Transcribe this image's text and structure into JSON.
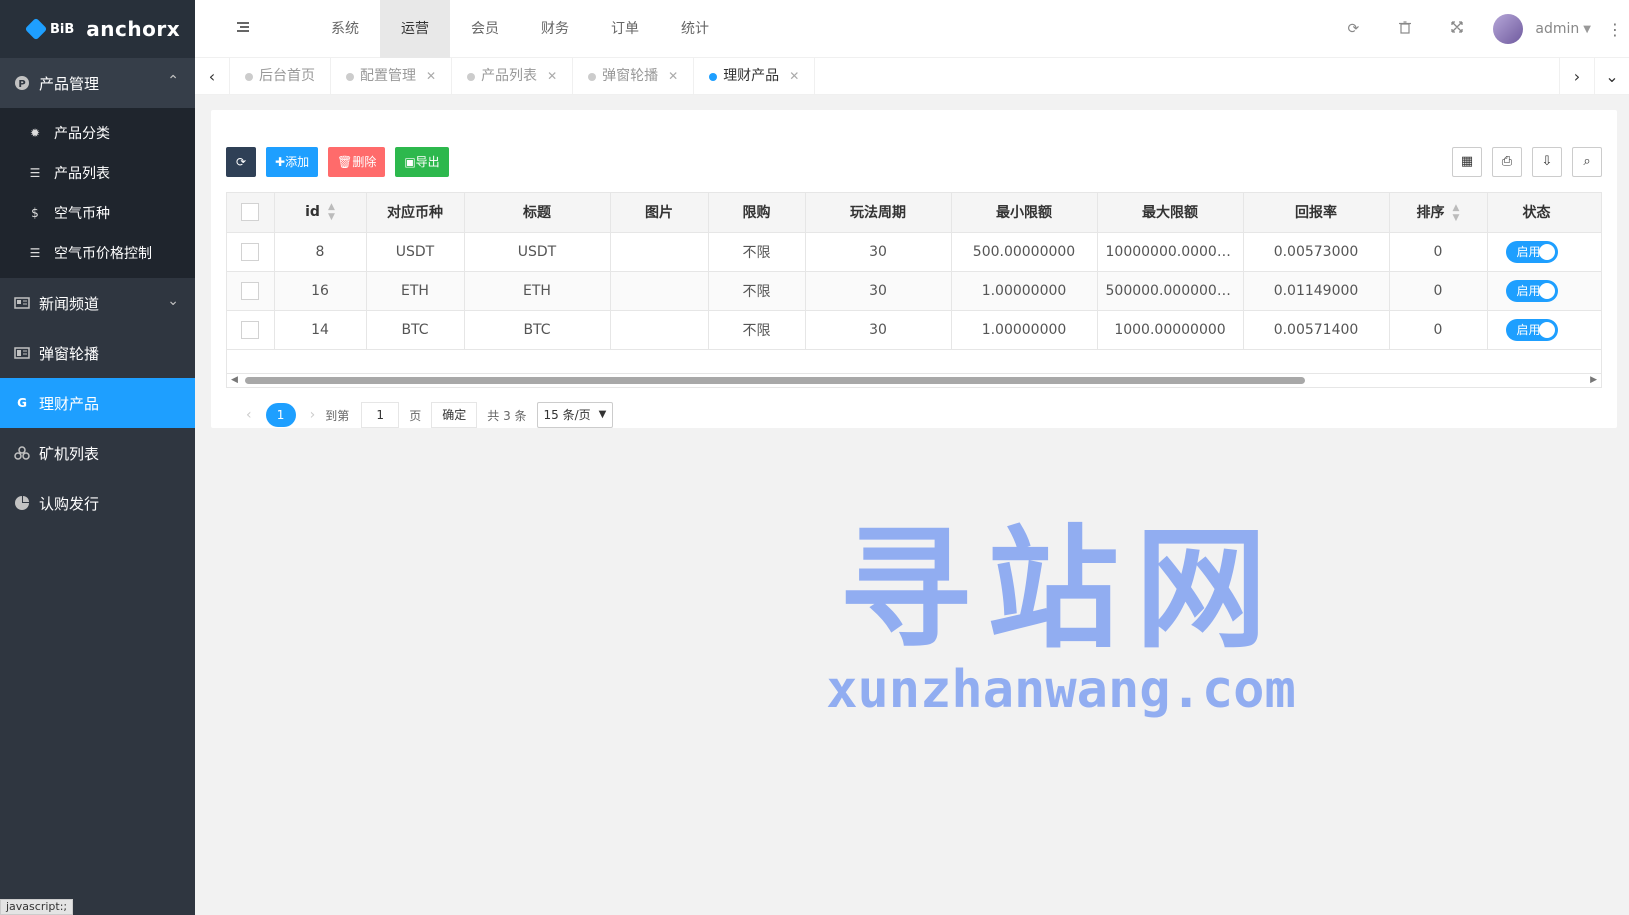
{
  "app": {
    "bib": "BiB",
    "name": "anchorx"
  },
  "sidebar": {
    "groups": [
      {
        "label": "产品管理",
        "icon": "product-icon",
        "open": true,
        "items": [
          {
            "label": "产品分类",
            "icon": "gear-icon"
          },
          {
            "label": "产品列表",
            "icon": "list-icon"
          },
          {
            "label": "空气币种",
            "icon": "coin-icon"
          },
          {
            "label": "空气币价格控制",
            "icon": "list-icon"
          }
        ]
      },
      {
        "label": "新闻频道",
        "icon": "news-icon"
      },
      {
        "label": "弹窗轮播",
        "icon": "carousel-icon"
      },
      {
        "label": "理财产品",
        "icon": "finance-icon",
        "active": true
      },
      {
        "label": "矿机列表",
        "icon": "miner-icon"
      },
      {
        "label": "认购发行",
        "icon": "pie-icon"
      }
    ]
  },
  "topnav": {
    "items": [
      "系统",
      "运营",
      "会员",
      "财务",
      "订单",
      "统计"
    ],
    "active": "运营"
  },
  "header": {
    "user": "admin"
  },
  "tabs": [
    {
      "label": "后台首页",
      "closable": false
    },
    {
      "label": "配置管理",
      "closable": true
    },
    {
      "label": "产品列表",
      "closable": true
    },
    {
      "label": "弹窗轮播",
      "closable": true
    },
    {
      "label": "理财产品",
      "closable": true,
      "active": true
    }
  ],
  "toolbar": {
    "add": "添加",
    "delete": "删除",
    "export": "导出"
  },
  "table": {
    "columns": [
      "id",
      "对应币种",
      "标题",
      "图片",
      "限购",
      "玩法周期",
      "最小限额",
      "最大限额",
      "回报率",
      "排序",
      "状态"
    ],
    "rows": [
      {
        "id": "8",
        "currency": "USDT",
        "title": "USDT",
        "image": "",
        "limit": "不限",
        "period": "30",
        "min": "500.00000000",
        "max": "10000000.00000000",
        "rate": "0.00573000",
        "sort": "0",
        "status": "启用"
      },
      {
        "id": "16",
        "currency": "ETH",
        "title": "ETH",
        "image": "",
        "limit": "不限",
        "period": "30",
        "min": "1.00000000",
        "max": "500000.00000000",
        "rate": "0.01149000",
        "sort": "0",
        "status": "启用"
      },
      {
        "id": "14",
        "currency": "BTC",
        "title": "BTC",
        "image": "",
        "limit": "不限",
        "period": "30",
        "min": "1.00000000",
        "max": "1000.00000000",
        "rate": "0.00571400",
        "sort": "0",
        "status": "启用"
      }
    ]
  },
  "pager": {
    "current": "1",
    "goto_label": "到第",
    "goto_value": "1",
    "page_label": "页",
    "confirm": "确定",
    "total": "共 3 条",
    "page_size": "15 条/页"
  },
  "watermark": {
    "cn": "寻站网",
    "en": "xunzhanwang.com"
  },
  "statusbar": "javascript:;"
}
